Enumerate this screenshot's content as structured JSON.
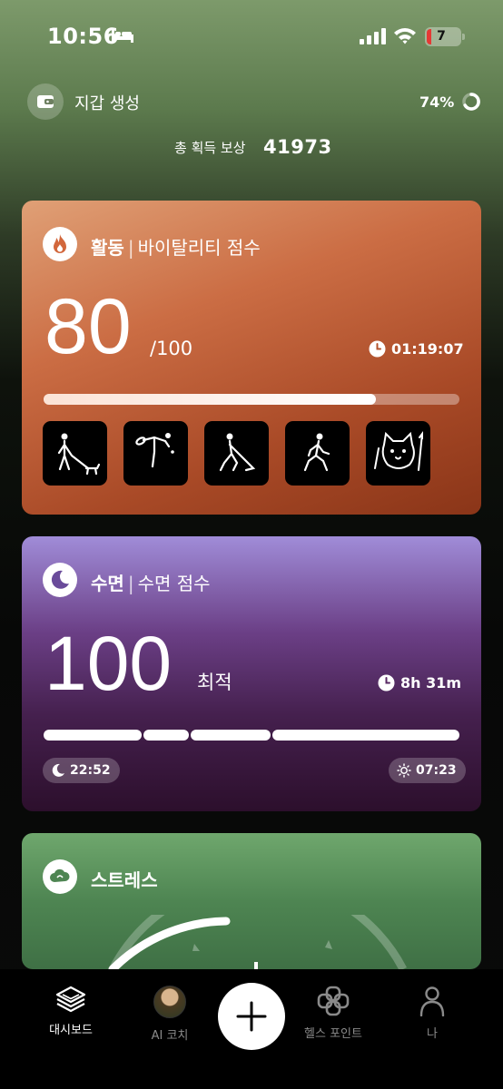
{
  "status_bar": {
    "time": "10:56",
    "battery": "7"
  },
  "header": {
    "wallet_label": "지갑 생성",
    "percent": "74%",
    "reward_label": "총 획득 보상",
    "reward_value": "41973"
  },
  "activity": {
    "title": "활동",
    "subtitle": "바이탈리티 점수",
    "score": "80",
    "max": "/100",
    "duration": "01:19:07",
    "progress_fraction": 0.8,
    "tiles": [
      "dog-walking-icon",
      "pickleball-icon",
      "golf-icon",
      "walking-icon",
      "cat-trend-icon"
    ],
    "accent": "#cb6d44"
  },
  "sleep": {
    "title": "수면",
    "subtitle": "수면 점수",
    "score": "100",
    "label": "최적",
    "duration": "8h 31m",
    "bedtime": "22:52",
    "waketime": "07:23",
    "accent": "#6b3f86"
  },
  "stress": {
    "title": "스트레스",
    "accent": "#4e8552"
  },
  "tabbar": {
    "dashboard": "대시보드",
    "coach": "AI 코치",
    "health_points": "헬스 포인트",
    "me": "나"
  }
}
